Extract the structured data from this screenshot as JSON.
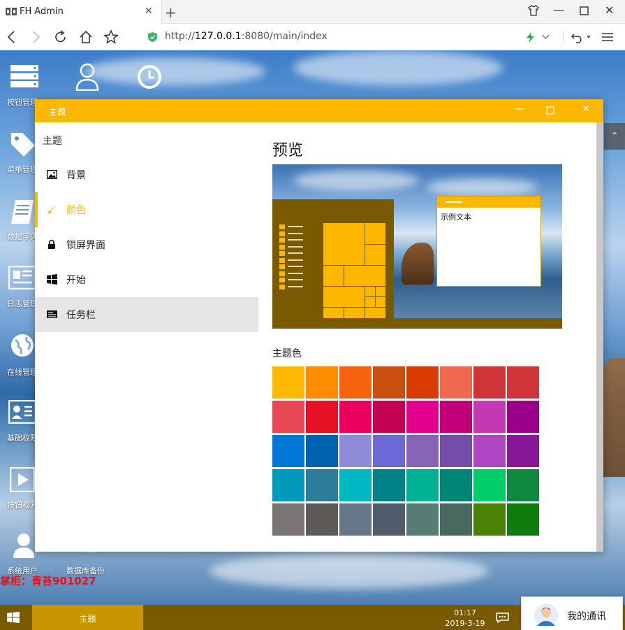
{
  "browser": {
    "tab_title": "FH Admin",
    "url_prefix": "http://",
    "url_host": "127.0.0.1",
    "url_rest": ":8080/main/index",
    "icons": [
      "back-icon",
      "forward-icon",
      "reload-icon",
      "home-icon",
      "star-icon",
      "shield-icon",
      "lightning-icon",
      "undo-icon",
      "menu-icon"
    ]
  },
  "desktop": {
    "icons": [
      {
        "label": "按钮管理"
      },
      {
        "label": "菜单管理"
      },
      {
        "label": "数据字典"
      },
      {
        "label": "日志管理"
      },
      {
        "label": "在线管理"
      },
      {
        "label": "基础权限"
      },
      {
        "label": "按钮权限"
      },
      {
        "label": "系统用户"
      },
      {
        "label": "数据库备份"
      }
    ],
    "watermark": "掌柜：青苔901027"
  },
  "theme_window": {
    "title": "主题",
    "sidebar_heading": "主题",
    "items": [
      {
        "label": "背景",
        "icon": "image-icon"
      },
      {
        "label": "颜色",
        "icon": "brush-icon"
      },
      {
        "label": "锁屏界面",
        "icon": "lock-icon"
      },
      {
        "label": "开始",
        "icon": "windows-icon"
      },
      {
        "label": "任务栏",
        "icon": "taskbar-icon"
      }
    ],
    "preview_title": "预览",
    "sample_text": "示例文本",
    "colors_title": "主题色",
    "accent": "#fcb800",
    "swatches": [
      "#ffb900",
      "#ff8c00",
      "#f7630c",
      "#ca5010",
      "#da3b01",
      "#ef6950",
      "#d13438",
      "#d13438",
      "#e74856",
      "#e81123",
      "#ea005e",
      "#c30052",
      "#e3008c",
      "#bf0077",
      "#c239b3",
      "#9a0089",
      "#0078d7",
      "#0063b1",
      "#8e8cd8",
      "#6b69d6",
      "#8764b8",
      "#744da9",
      "#b146c2",
      "#881798",
      "#0099bc",
      "#2d7d9a",
      "#00b7c3",
      "#038387",
      "#00b294",
      "#018574",
      "#00cc6a",
      "#10893e",
      "#7a7574",
      "#5d5a58",
      "#68768a",
      "#515c6b",
      "#567c73",
      "#486860",
      "#498205",
      "#107c10"
    ]
  },
  "taskbar": {
    "active_item": "主题",
    "time": "01:17",
    "date": "2019-3-19",
    "comm_label": "我的通讯"
  }
}
